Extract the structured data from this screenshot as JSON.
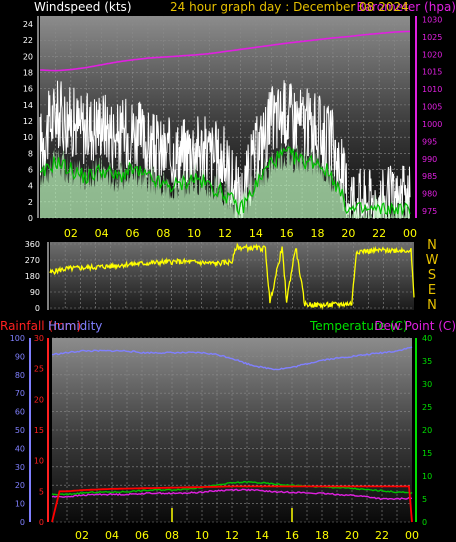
{
  "header": {
    "left_title": "Windspeed (kts)",
    "center_title": "24 hour graph day : December 08 2024",
    "right_title": "Barometer (hpa)"
  },
  "bottom_header": {
    "rainfall": "Rainfall (mm)",
    "humidity": "Humidity",
    "temperature": "Temperature (C)",
    "dewpoint": "Dew Point (C)"
  },
  "compass_labels": [
    "N",
    "W",
    "S",
    "E",
    "N"
  ],
  "colors": {
    "wind_gust": "#ffffff",
    "wind_avg": "#b8f0b8",
    "wind_avg_line": "#00c000",
    "barometer": "#e020e0",
    "direction": "#ffff00",
    "humidity": "#8080ff",
    "temperature": "#00c000",
    "dewpoint": "#e020e0",
    "rainfall": "#ff0000",
    "time_axis": "#ffff00"
  },
  "chart_data": [
    {
      "id": "wind_baro",
      "type": "line",
      "x_tick_labels": [
        "02",
        "04",
        "06",
        "08",
        "10",
        "12",
        "14",
        "16",
        "18",
        "20",
        "22",
        "00"
      ],
      "y_left": {
        "label": "Windspeed (kts)",
        "ticks": [
          "0",
          "2",
          "4",
          "6",
          "8",
          "10",
          "12",
          "14",
          "16",
          "18",
          "20",
          "22",
          "24"
        ],
        "ylim": [
          0,
          25
        ]
      },
      "y_right": {
        "label": "Barometer (hpa)",
        "ticks": [
          "975",
          "980",
          "985",
          "990",
          "995",
          "1000",
          "1005",
          "1010",
          "1015",
          "1020",
          "1025",
          "1030"
        ],
        "ylim": [
          973,
          1031
        ]
      },
      "series": [
        {
          "name": "gust",
          "hours": [
            0,
            1,
            2,
            3,
            4,
            5,
            6,
            7,
            8,
            9,
            10,
            11,
            12,
            13,
            14,
            15,
            16,
            17,
            18,
            19,
            20,
            21,
            22,
            23,
            24
          ],
          "values": [
            9,
            13,
            12,
            11,
            12,
            10,
            11,
            9,
            8,
            8,
            9,
            8,
            7,
            2,
            8,
            12,
            13,
            12,
            11,
            9,
            3,
            2,
            2,
            2,
            2
          ]
        },
        {
          "name": "average",
          "hours": [
            0,
            1,
            2,
            3,
            4,
            5,
            6,
            7,
            8,
            9,
            10,
            11,
            12,
            13,
            14,
            15,
            16,
            17,
            18,
            19,
            20,
            21,
            22,
            23,
            24
          ],
          "values": [
            5,
            7,
            6,
            5,
            6,
            5,
            6,
            5,
            4,
            4,
            5,
            4,
            3,
            1,
            4,
            7,
            8,
            7,
            7,
            5,
            1,
            1,
            1,
            1,
            1
          ]
        },
        {
          "name": "barometer",
          "hours": [
            0,
            1,
            2,
            3,
            4,
            5,
            6,
            7,
            8,
            9,
            10,
            11,
            12,
            13,
            14,
            15,
            16,
            17,
            18,
            19,
            20,
            21,
            22,
            23,
            24
          ],
          "values": [
            1015.5,
            1015.3,
            1015.6,
            1016.2,
            1017.0,
            1017.8,
            1018.4,
            1018.9,
            1019.2,
            1019.5,
            1019.8,
            1020.2,
            1020.8,
            1021.4,
            1022.0,
            1022.6,
            1023.2,
            1023.7,
            1024.2,
            1024.7,
            1025.1,
            1025.6,
            1026.0,
            1026.4,
            1026.6
          ]
        }
      ]
    },
    {
      "id": "direction",
      "type": "line",
      "y_ticks": [
        "360",
        "270",
        "180",
        "90",
        "0"
      ],
      "ylim": [
        0,
        360
      ],
      "series": [
        {
          "name": "wind_direction",
          "hours": [
            0,
            1,
            2,
            3,
            4,
            5,
            6,
            7,
            8,
            9,
            10,
            11,
            12,
            12.3,
            12.5,
            14.2,
            14.5,
            15.3,
            15.6,
            16.2,
            16.8,
            17,
            18,
            19,
            19.9,
            20.2,
            21,
            22,
            23,
            23.8,
            24
          ],
          "values": [
            200,
            220,
            225,
            230,
            235,
            245,
            250,
            255,
            260,
            260,
            255,
            250,
            260,
            345,
            340,
            335,
            30,
            340,
            40,
            345,
            20,
            20,
            15,
            20,
            25,
            320,
            320,
            325,
            325,
            325,
            60
          ]
        }
      ]
    },
    {
      "id": "rain_hum_temp",
      "type": "line",
      "x_tick_labels": [
        "02",
        "04",
        "06",
        "08",
        "10",
        "12",
        "14",
        "16",
        "18",
        "20",
        "22",
        "00"
      ],
      "y_left": {
        "label": "Humidity",
        "ticks": [
          "0",
          "10",
          "20",
          "30",
          "40",
          "50",
          "60",
          "70",
          "80",
          "90",
          "100"
        ],
        "ylim": [
          0,
          100
        ]
      },
      "y_rain": {
        "label": "Rainfall (mm)",
        "ticks": [
          "0",
          "5",
          "10",
          "15",
          "20",
          "25",
          "30"
        ],
        "ylim": [
          0,
          30
        ]
      },
      "y_right": {
        "label": "Temperature (C)",
        "ticks": [
          "0",
          "5",
          "10",
          "15",
          "20",
          "25",
          "30",
          "35",
          "40"
        ],
        "ylim": [
          0,
          40
        ]
      },
      "series": [
        {
          "name": "humidity",
          "hours": [
            0,
            1,
            2,
            3,
            4,
            5,
            6,
            7,
            8,
            9,
            10,
            11,
            12,
            13,
            14,
            15,
            16,
            17,
            18,
            19,
            20,
            21,
            22,
            23,
            24
          ],
          "values": [
            91,
            92,
            93,
            93,
            93,
            93,
            92,
            92,
            92,
            92,
            92,
            91,
            89,
            86,
            84,
            83,
            84,
            86,
            88,
            89,
            90,
            91,
            92,
            93,
            95
          ]
        },
        {
          "name": "temperature",
          "hours": [
            0,
            1,
            2,
            3,
            4,
            5,
            6,
            7,
            8,
            9,
            10,
            11,
            12,
            13,
            14,
            15,
            16,
            17,
            18,
            19,
            20,
            21,
            22,
            23,
            24
          ],
          "values": [
            6,
            6,
            6.3,
            6.5,
            6.5,
            6.6,
            6.8,
            7,
            7,
            7.2,
            7.5,
            8,
            8.5,
            8.7,
            8.5,
            8.2,
            8,
            7.8,
            7.6,
            7.5,
            7.3,
            7,
            6.8,
            6.5,
            6.3
          ]
        },
        {
          "name": "dewpoint",
          "hours": [
            0,
            1,
            2,
            3,
            4,
            5,
            6,
            7,
            8,
            9,
            10,
            11,
            12,
            13,
            14,
            15,
            16,
            17,
            18,
            19,
            20,
            21,
            22,
            23,
            24
          ],
          "values": [
            5.5,
            5.5,
            5.8,
            6,
            6,
            6,
            6.2,
            6.3,
            6.2,
            6.3,
            6.5,
            6.8,
            7,
            7,
            6.8,
            6.5,
            6.5,
            6.3,
            6.2,
            6,
            5.8,
            5.5,
            5,
            5,
            5.2
          ]
        },
        {
          "name": "rainfall",
          "hours": [
            0,
            0.3,
            0.5,
            1,
            2,
            4,
            6,
            8,
            10,
            12,
            14,
            16,
            18,
            20,
            22,
            23.8,
            24
          ],
          "values": [
            0,
            3,
            5,
            5,
            5.2,
            5.4,
            5.5,
            5.6,
            5.7,
            5.8,
            5.8,
            5.8,
            5.8,
            5.8,
            5.8,
            5.8,
            0
          ]
        }
      ]
    }
  ]
}
